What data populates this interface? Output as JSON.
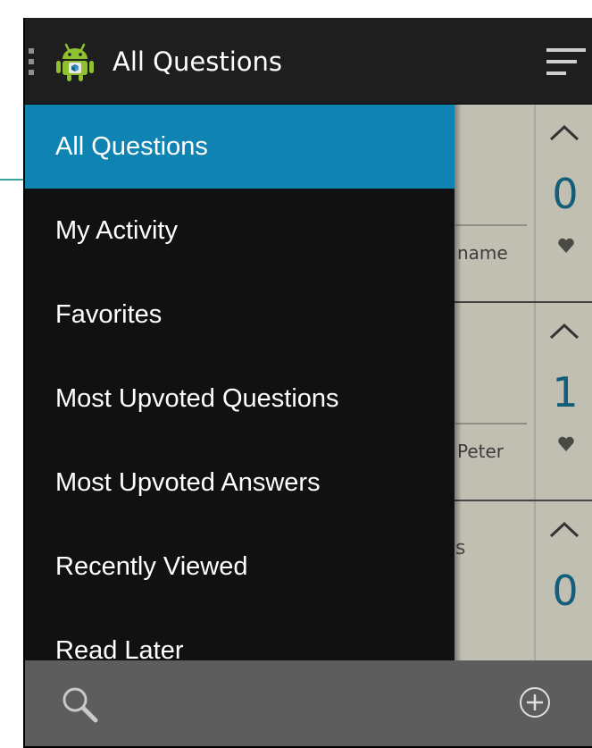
{
  "action_bar": {
    "title": "All Questions",
    "app_icon": "android-logo-icon",
    "left_icon": "drawer-indicator-icon",
    "right_icon": "sort-icon"
  },
  "drawer": {
    "items": [
      {
        "label": "All Questions",
        "active": true
      },
      {
        "label": "My Activity",
        "active": false
      },
      {
        "label": "Favorites",
        "active": false
      },
      {
        "label": "Most Upvoted Questions",
        "active": false
      },
      {
        "label": "Most Upvoted Answers",
        "active": false
      },
      {
        "label": "Recently Viewed",
        "active": false
      },
      {
        "label": "Read Later",
        "active": false
      }
    ]
  },
  "questions": [
    {
      "partial_title": "",
      "author": "name",
      "votes": "0"
    },
    {
      "partial_title": "",
      "author": "Peter",
      "votes": "1"
    },
    {
      "partial_title": "s",
      "author": "",
      "votes": "0"
    }
  ],
  "bottom_bar": {
    "left_icon": "search-icon",
    "right_icon": "add-circle-icon"
  },
  "colors": {
    "accent": "#0f84b2",
    "vote_count": "#135e7b",
    "drawer_bg": "#111111",
    "content_bg": "#c0bfb2",
    "bottom_bar_bg": "#5d5d5d"
  }
}
